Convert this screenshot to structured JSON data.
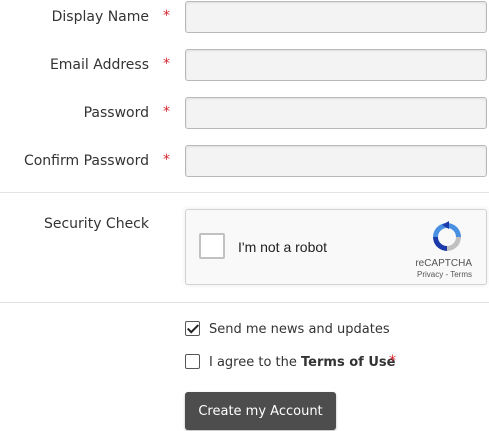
{
  "form": {
    "fields": [
      {
        "label": "Display Name",
        "required": "*",
        "value": ""
      },
      {
        "label": "Email Address",
        "required": "*",
        "value": ""
      },
      {
        "label": "Password",
        "required": "*",
        "value": ""
      },
      {
        "label": "Confirm Password",
        "required": "*",
        "value": ""
      }
    ],
    "security_label": "Security Check",
    "captcha": {
      "text": "I'm not a robot",
      "brand": "reCAPTCHA",
      "links": "Privacy - Terms",
      "icon": "recaptcha-logo-icon"
    },
    "newsletter": {
      "label": "Send me news and updates",
      "checked": true
    },
    "terms": {
      "prefix": "I agree to the",
      "link": "Terms of Use",
      "required": "*",
      "checked": false
    },
    "submit_label": "Create my Account"
  },
  "colors": {
    "required": "#d9262f",
    "button_bg": "#4d4d4d",
    "input_bg": "#f3f3f3"
  }
}
